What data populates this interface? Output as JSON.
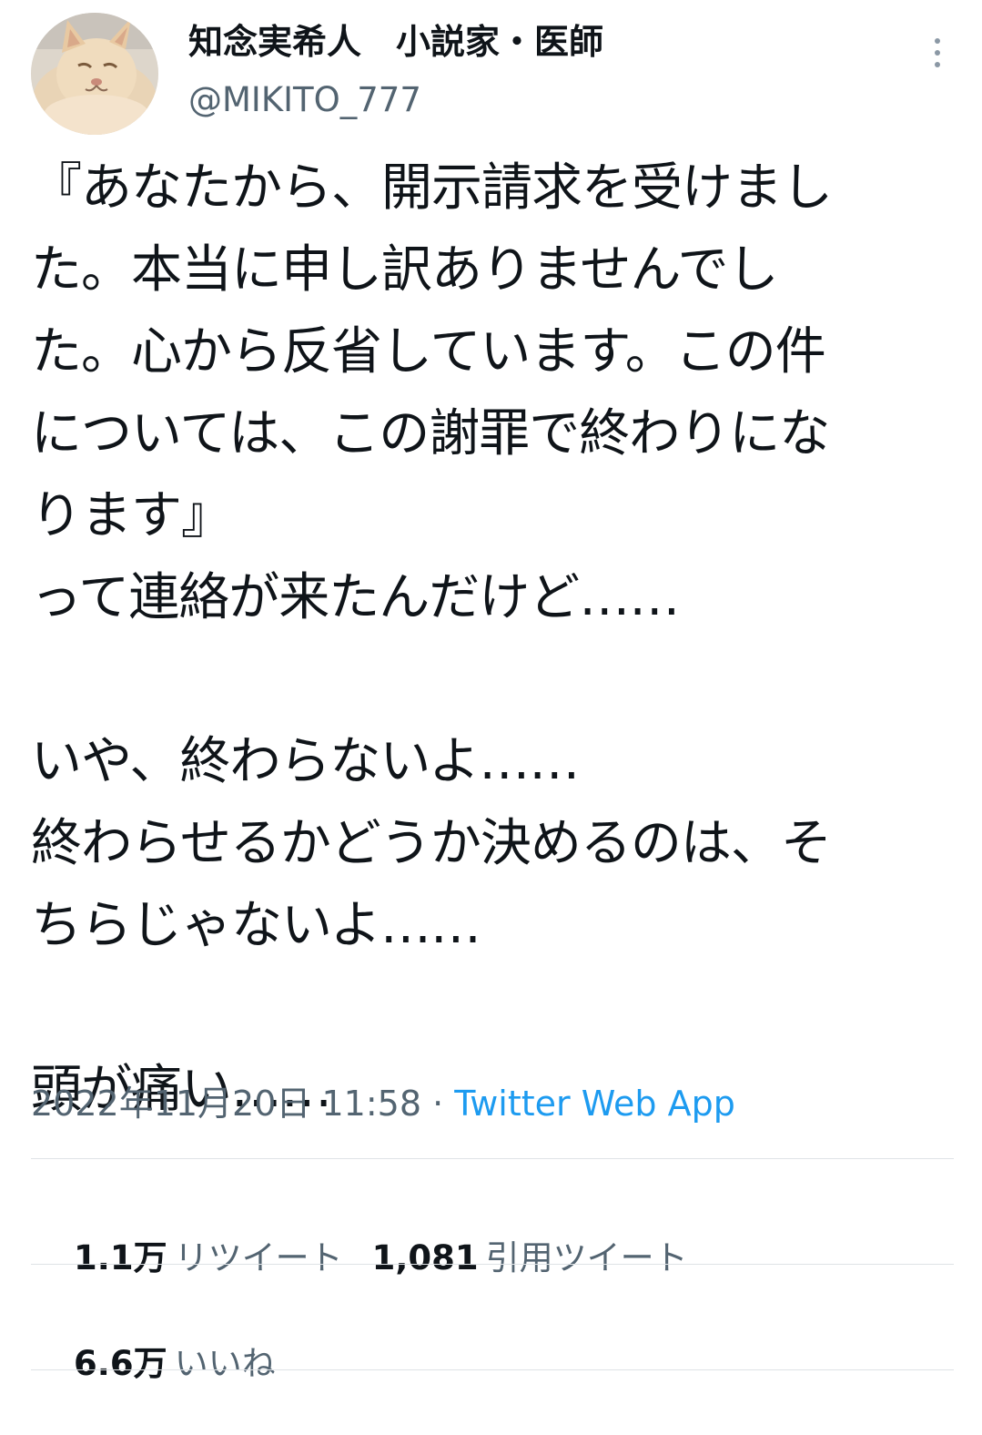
{
  "user": {
    "display_name": "知念実希人　小説家・医師",
    "handle": "@MIKITO_777"
  },
  "tweet": {
    "lines": [
      "『あなたから、開示請求を受けまし",
      "た。本当に申し訳ありませんでし",
      "た。心から反省しています。この件",
      "については、この謝罪で終わりにな",
      "ります』",
      "って連絡が来たんだけど……",
      "",
      "いや、終わらないよ……",
      "終わらせるかどうか決めるのは、そ",
      "ちらじゃないよ……",
      "",
      "頭が痛い……"
    ]
  },
  "meta": {
    "timestamp": "2022年11月20日 11:58",
    "separator": " · ",
    "source": "Twitter Web App"
  },
  "stats": {
    "retweets_count": "1.1万",
    "retweets_label": "リツイート",
    "quotes_count": "1,081",
    "quotes_label": "引用ツイート",
    "likes_count": "6.6万",
    "likes_label": "いいね"
  },
  "icons": {
    "more": "more-vertical-icon"
  },
  "colors": {
    "text": "#0f1419",
    "secondary": "#536471",
    "link": "#1d9bf0",
    "divider": "#dfe3e6"
  }
}
